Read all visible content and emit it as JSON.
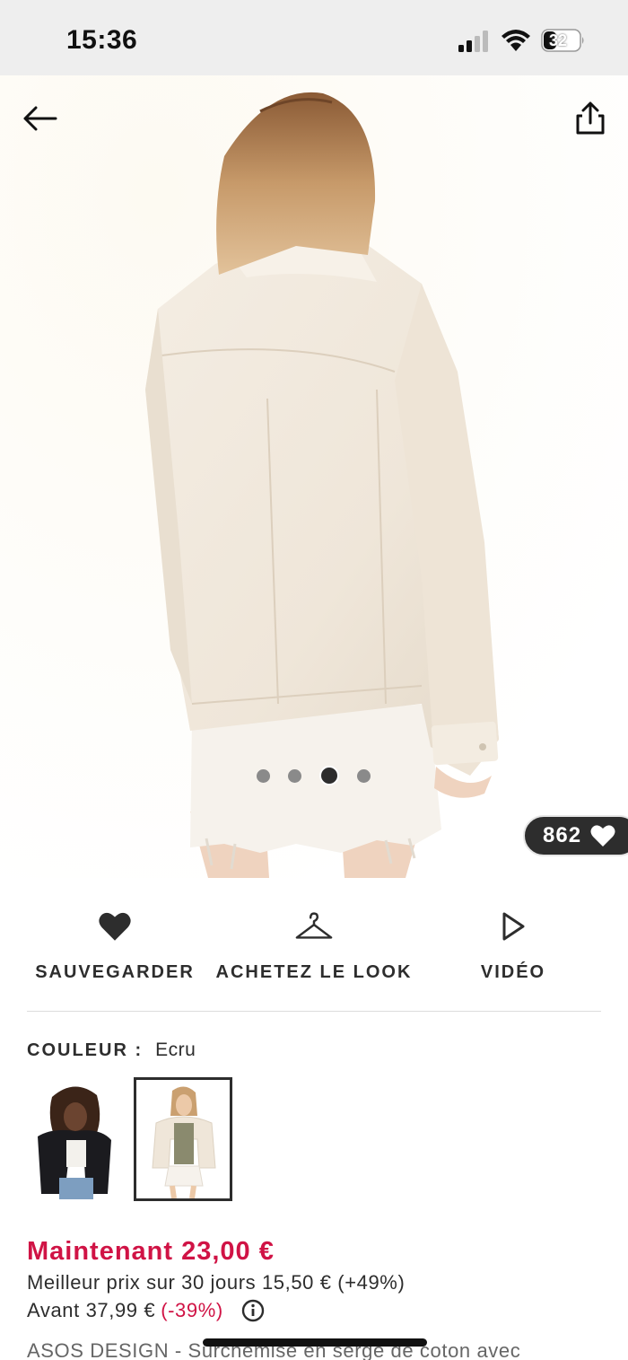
{
  "status_bar": {
    "time": "15:36",
    "battery": "32"
  },
  "product_gallery": {
    "image_count": 4,
    "active_index": 2,
    "likes": "862"
  },
  "actions": {
    "save_label": "SAUVEGARDER",
    "shop_look_label": "ACHETEZ LE LOOK",
    "video_label": "VIDÉO"
  },
  "colour": {
    "label": "COULEUR :",
    "value": "Ecru",
    "selected_index": 1
  },
  "price": {
    "now": "Maintenant 23,00 €",
    "best_30_days": "Meilleur prix sur 30 jours 15,50 € (+49%)",
    "before_label": "Avant 37,99 €",
    "before_discount": "(-39%)"
  },
  "description": "ASOS DESIGN - Surchemise en sergé de coton avec",
  "colors": {
    "sale_red": "#d01345",
    "text_dark": "#2d2d2d",
    "status_bg": "#eeeeee"
  },
  "icons": [
    "back-arrow-icon",
    "share-icon",
    "heart-icon",
    "hanger-icon",
    "play-icon",
    "info-icon"
  ]
}
